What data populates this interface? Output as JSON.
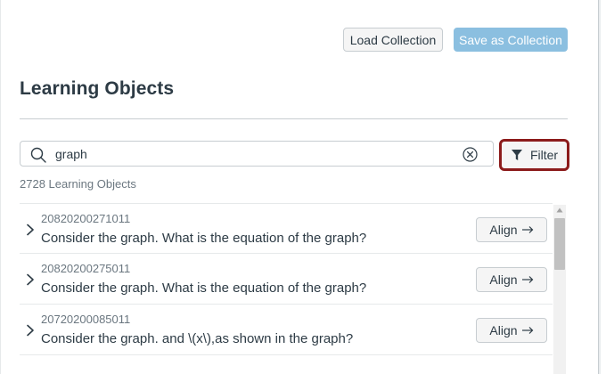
{
  "toolbar": {
    "load_label": "Load Collection",
    "save_label": "Save as Collection"
  },
  "page_title": "Learning Objects",
  "search": {
    "value": "graph",
    "placeholder": ""
  },
  "filter_label": "Filter",
  "count_text": "2728 Learning Objects",
  "items": [
    {
      "id": "20820200271011",
      "text": "Consider the graph. What is the equation of the graph?",
      "action": "Align"
    },
    {
      "id": "20820200275011",
      "text": "Consider the graph. What is the equation of the graph?",
      "action": "Align"
    },
    {
      "id": "20720200085011",
      "text": "Consider the graph. and \\(x\\),as shown in the graph?",
      "action": "Align"
    }
  ],
  "colors": {
    "accent": "#8bbfe0",
    "filter_border": "#8c1b1b",
    "text": "#2d3b45"
  }
}
